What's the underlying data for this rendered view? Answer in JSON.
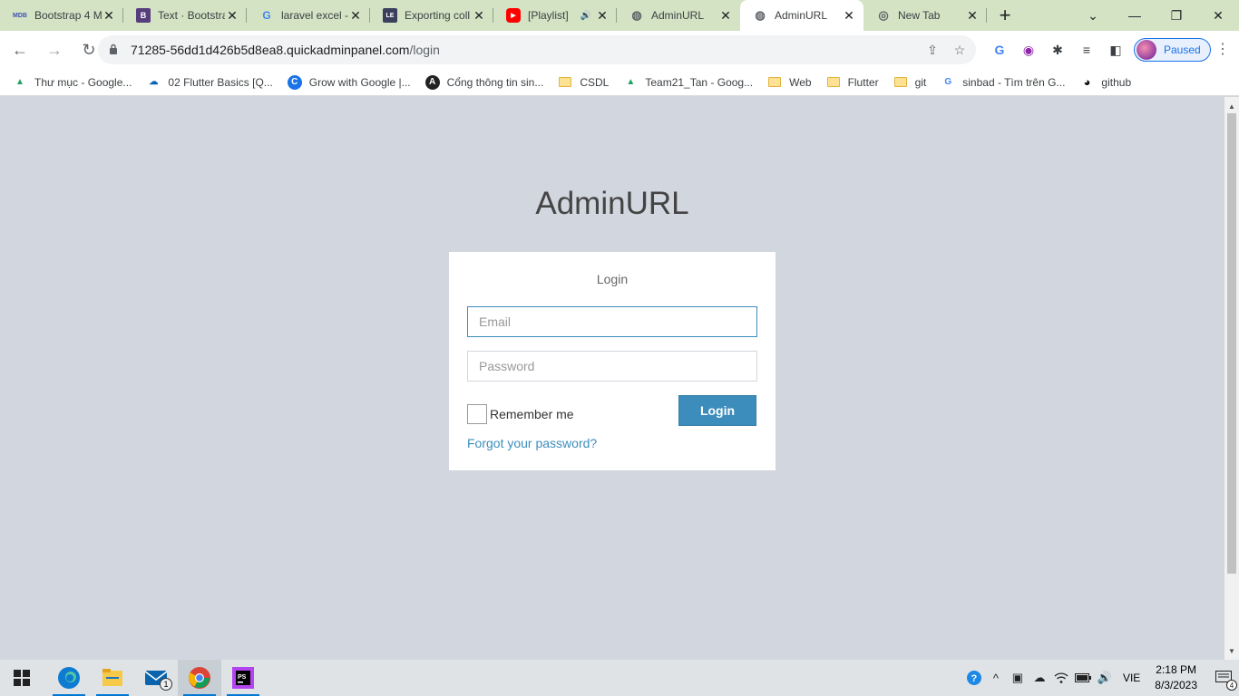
{
  "browser": {
    "tabs": [
      {
        "title": "Bootstrap 4 M",
        "icon": "mdb-icon",
        "icon_text": "MDB",
        "active": false
      },
      {
        "title": "Text · Bootstra",
        "icon": "bootstrap-icon",
        "icon_text": "B",
        "active": false
      },
      {
        "title": "laravel excel -",
        "icon": "google-icon",
        "icon_text": "G",
        "active": false
      },
      {
        "title": "Exporting coll",
        "icon": "laravel-excel-icon",
        "icon_text": "LE",
        "active": false
      },
      {
        "title": "[Playlist] ",
        "icon": "youtube-icon",
        "icon_text": "▶",
        "active": false,
        "audio": true
      },
      {
        "title": "AdminURL",
        "icon": "globe-icon",
        "icon_text": "◍",
        "active": false
      },
      {
        "title": "AdminURL",
        "icon": "globe-icon",
        "icon_text": "◍",
        "active": true
      },
      {
        "title": "New Tab",
        "icon": "chrome-icon",
        "icon_text": "◎",
        "active": false
      }
    ],
    "new_tab_symbol": "+",
    "window_controls": {
      "tab_search": "⌄",
      "minimize": "—",
      "restore": "❐",
      "close": "✕"
    },
    "nav": {
      "back": "←",
      "forward": "→",
      "reload": "↻"
    },
    "url_host": "71285-56dd1d426b5d8ea8.quickadminpanel.com",
    "url_path": "/login",
    "omnibox_actions": {
      "share": "⇪",
      "bookmark_star": "☆"
    },
    "extensions": [
      "G",
      "◉",
      "✱",
      "≡",
      "◧"
    ],
    "profile_label": "Paused",
    "menu": "⋮"
  },
  "bookmarks": [
    {
      "label": "Thư mục - Google...",
      "icon": "google-drive-icon",
      "icon_text": "▲"
    },
    {
      "label": "02 Flutter Basics [Q...",
      "icon": "onedrive-icon",
      "icon_text": "☁"
    },
    {
      "label": "Grow with Google |...",
      "icon": "grow-google-icon",
      "icon_text": "C"
    },
    {
      "label": "Cổng thông tin sin...",
      "icon": "angular-icon",
      "icon_text": "A"
    },
    {
      "label": "CSDL",
      "icon": "folder-icon",
      "icon_text": ""
    },
    {
      "label": "Team21_Tan - Goog...",
      "icon": "google-drive-icon",
      "icon_text": "▲"
    },
    {
      "label": "Web",
      "icon": "folder-icon",
      "icon_text": ""
    },
    {
      "label": "Flutter",
      "icon": "folder-icon",
      "icon_text": ""
    },
    {
      "label": "git",
      "icon": "folder-icon",
      "icon_text": ""
    },
    {
      "label": "sinbad - Tìm trên G...",
      "icon": "google-icon",
      "icon_text": "G"
    },
    {
      "label": "github",
      "icon": "github-icon",
      "icon_text": "◕"
    }
  ],
  "login": {
    "app_name": "AdminURL",
    "box_message": "Login",
    "email_placeholder": "Email",
    "email_value": "",
    "password_placeholder": "Password",
    "remember_label": "Remember me",
    "remember_checked": false,
    "submit_label": "Login",
    "forgot_label": "Forgot your password?"
  },
  "taskbar": {
    "apps": [
      {
        "name": "edge-icon",
        "active": false
      },
      {
        "name": "file-explorer-icon",
        "active": false
      },
      {
        "name": "mail-icon",
        "active": false,
        "badge": "1"
      },
      {
        "name": "chrome-icon",
        "active": true
      },
      {
        "name": "phpstorm-icon",
        "active": false
      }
    ],
    "language": "VIE",
    "time": "2:18 PM",
    "date": "8/3/2023",
    "notification_count": "4"
  },
  "colors": {
    "page_background": "#d2d6de",
    "primary": "#3c8dbc",
    "tabstrip": "#d3e3c4"
  }
}
